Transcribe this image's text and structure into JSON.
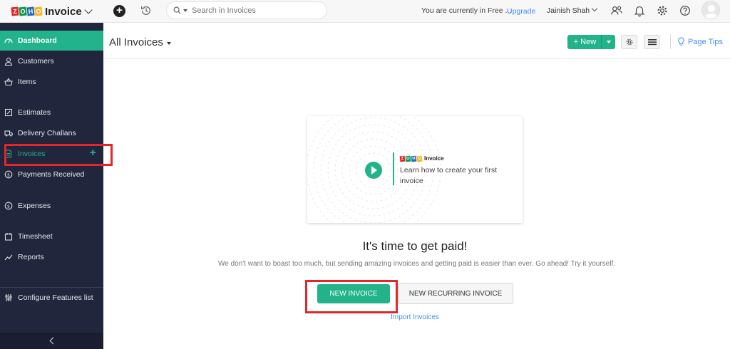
{
  "app": {
    "logo_letters": [
      "Z",
      "O",
      "H",
      "O"
    ],
    "logo_colors": [
      "#e42527",
      "#089949",
      "#226db4",
      "#f9b21d"
    ],
    "name": "Invoice"
  },
  "topbar": {
    "search_placeholder": "Search in Invoices",
    "trial_text": "You are currently in Free ...",
    "upgrade_label": "Upgrade",
    "user_name": "Jainish Shah"
  },
  "sidebar": {
    "items": [
      {
        "label": "Dashboard",
        "icon": "dashboard-icon"
      },
      {
        "label": "Customers",
        "icon": "user-icon"
      },
      {
        "label": "Items",
        "icon": "basket-icon"
      },
      {
        "label": "Estimates",
        "icon": "estimate-icon"
      },
      {
        "label": "Delivery Challans",
        "icon": "truck-icon"
      },
      {
        "label": "Invoices",
        "icon": "invoice-icon"
      },
      {
        "label": "Payments Received",
        "icon": "payment-icon"
      },
      {
        "label": "Expenses",
        "icon": "expense-icon"
      },
      {
        "label": "Timesheet",
        "icon": "calendar-icon"
      },
      {
        "label": "Reports",
        "icon": "chart-icon"
      },
      {
        "label": "Configure Features list",
        "icon": "sliders-icon"
      }
    ],
    "active_item": "Dashboard",
    "selected_item": "Invoices"
  },
  "header": {
    "title": "All Invoices",
    "new_label": "New",
    "page_tips_label": "Page Tips"
  },
  "video": {
    "brand": "Invoice",
    "caption": "Learn how to create your first invoice"
  },
  "empty_state": {
    "headline": "It's time to get paid!",
    "subtext": "We don't want to boast too much, but sending amazing invoices and getting paid is easier than ever. Go ahead! Try it yourself.",
    "primary_button": "NEW INVOICE",
    "secondary_button": "NEW RECURRING INVOICE",
    "import_link": "Import Invoices"
  },
  "colors": {
    "accent": "#22b38a",
    "sidebar_bg": "#21263c",
    "link": "#408dfb",
    "highlight_box": "#e3262b"
  }
}
